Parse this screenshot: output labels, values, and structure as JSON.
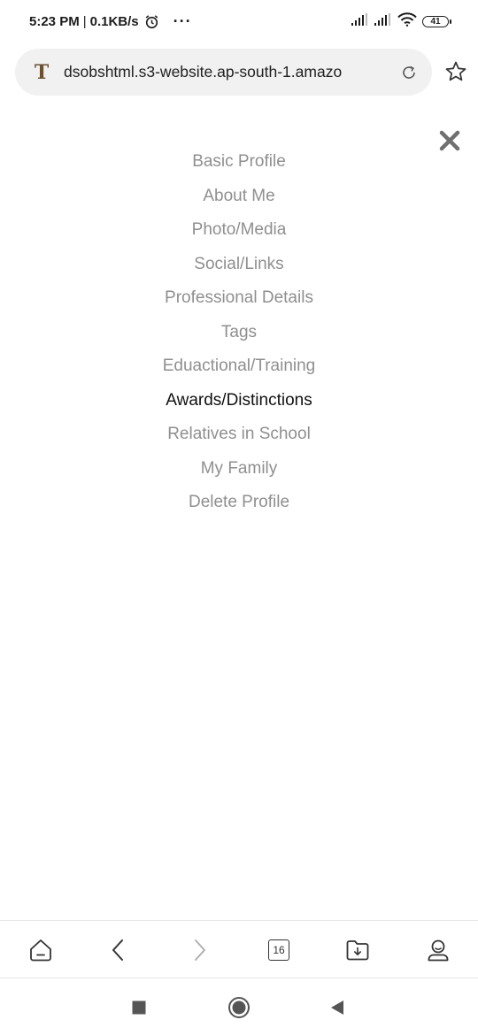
{
  "status_bar": {
    "time": "5:23 PM",
    "separator": "|",
    "speed": "0.1KB/s",
    "more": "···",
    "battery": "41"
  },
  "browser": {
    "site_icon": "T",
    "url": "dsobshtml.s3-website.ap-south-1.amazo",
    "tab_count": "16"
  },
  "menu": {
    "items": [
      {
        "label": "Basic Profile"
      },
      {
        "label": "About Me"
      },
      {
        "label": "Photo/Media"
      },
      {
        "label": "Social/Links"
      },
      {
        "label": "Professional Details"
      },
      {
        "label": "Tags"
      },
      {
        "label": "Eduactional/Training"
      },
      {
        "label": "Awards/Distinctions"
      },
      {
        "label": "Relatives in School"
      },
      {
        "label": "My Family"
      },
      {
        "label": "Delete Profile"
      }
    ],
    "active_label": "Awards/Distinctions"
  },
  "icons": {
    "alarm": "alarm-icon",
    "signal": "signal-icon",
    "wifi": "wifi-icon",
    "battery": "battery-icon",
    "reload": "reload-icon",
    "star": "star-icon",
    "close": "close-icon",
    "home": "home-icon",
    "back": "back-arrow-icon",
    "forward": "forward-arrow-icon",
    "tabs": "tabs-icon",
    "downloads": "download-folder-icon",
    "profile": "profile-icon"
  },
  "colors": {
    "menu_inactive": "#8f8f8f",
    "menu_active": "#111111",
    "close": "#707070",
    "address_bg": "#f1f1f1"
  }
}
